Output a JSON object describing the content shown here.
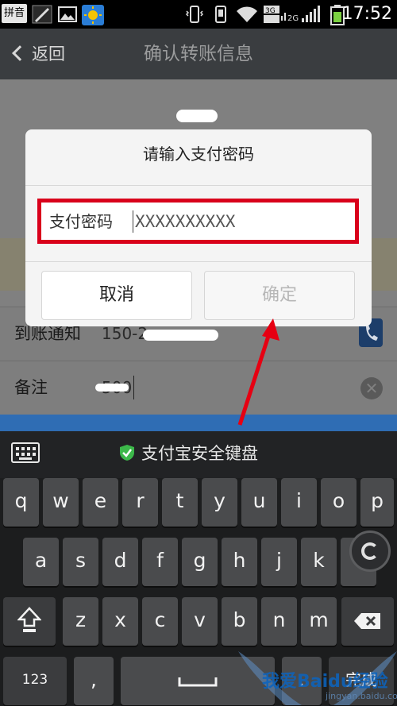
{
  "status_bar": {
    "ime_label": "拼音",
    "net_3g_a": "3G",
    "net_2g": "2G",
    "time": "17:52"
  },
  "app": {
    "back_label": "返回",
    "title": "确认转账信息",
    "row_notify_label": "到账通知",
    "row_notify_value": "150-2",
    "row_note_label": "备注",
    "row_note_value": "500"
  },
  "dialog": {
    "title": "请输入支付密码",
    "password_label": "支付密码",
    "password_value": "XXXXXXXXXX",
    "cancel_label": "取消",
    "confirm_label": "确定"
  },
  "keyboard": {
    "title": "支付宝安全键盘",
    "row1": [
      "q",
      "w",
      "e",
      "r",
      "t",
      "y",
      "u",
      "i",
      "o",
      "p"
    ],
    "row2": [
      "a",
      "s",
      "d",
      "f",
      "g",
      "h",
      "j",
      "k",
      "l"
    ],
    "row3": [
      "z",
      "x",
      "c",
      "v",
      "b",
      "n",
      "m"
    ],
    "num_label": "123",
    "comma_label": ",",
    "period_label": ".",
    "done_label": "完成"
  },
  "watermark": {
    "text": "我爱Baidu经验",
    "url": "jingyan.baidu.com"
  },
  "colors": {
    "highlight_red": "#d9001b",
    "keyboard_accent": "#2f6db4",
    "shield_green": "#3cb84a"
  }
}
